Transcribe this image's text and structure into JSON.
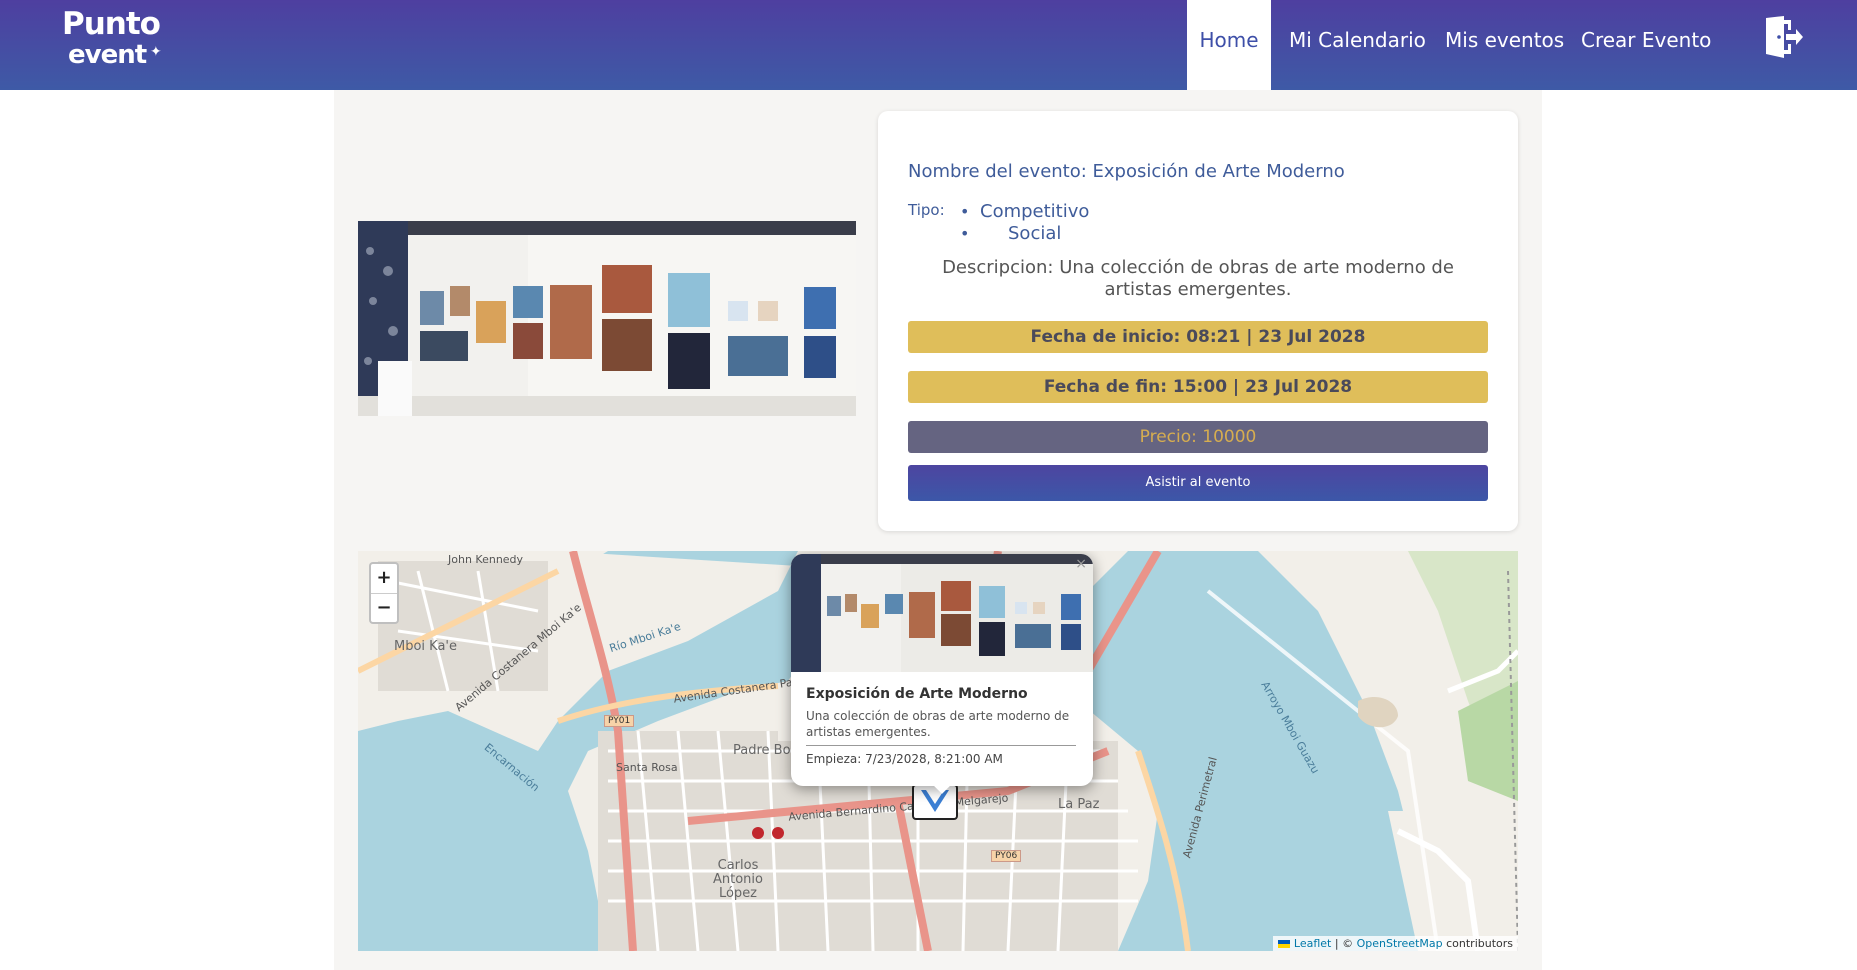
{
  "app": {
    "logo_line1": "Punto",
    "logo_line2": "event",
    "colors": {
      "nav_start": "#4e3fa0",
      "nav_end": "#3e5aa6",
      "date_bar": "#dfbe5a",
      "price_bar": "#656481",
      "accent_text": "#3f5c9a"
    }
  },
  "nav": {
    "items": [
      {
        "label": "Home",
        "active": true
      },
      {
        "label": "Mi Calendario",
        "active": false
      },
      {
        "label": "Mis eventos",
        "active": false
      },
      {
        "label": "Crear Evento",
        "active": false
      }
    ],
    "logout_icon": "logout-door-icon"
  },
  "event": {
    "name": "Nombre del evento: Exposición de Arte Moderno",
    "tipo_label": "Tipo:",
    "tipos": [
      "Competitivo",
      "Social"
    ],
    "description": "Descripcion: Una colección de obras de arte moderno de artistas emergentes.",
    "fecha_inicio": "Fecha de inicio: 08:21 | 23 Jul 2028",
    "fecha_fin": "Fecha de fin: 15:00 | 23 Jul 2028",
    "precio": "Precio: 10000",
    "attend_button": "Asistir al evento"
  },
  "map": {
    "zoom_in": "+",
    "zoom_out": "−",
    "labels": {
      "mboi_kae": "Mboi Ka'e",
      "rio_mboi": "Río Mboi Ka'e",
      "costanera_mboi": "Avenida Costanera Mboi Ka'e",
      "john_kennedy": "John Kennedy",
      "costanera_padre": "Avenida Costanera Padre",
      "padre_bolik": "Padre Bolik",
      "santa_rosa": "Santa Rosa",
      "encarnacion": "Encarnación",
      "bernardino": "Avenida Bernardino Caballero Melgarejo",
      "carlos_lopez": "Carlos Antonio López",
      "la_paz": "La Paz",
      "perimetral": "Avenida Perimetral",
      "arroyo": "Arroyo Mboi Guazu",
      "py01": "PY01",
      "py06": "PY06"
    },
    "popup": {
      "title": "Exposición de Arte Moderno",
      "description": "Una colección de obras de arte moderno de artistas emergentes.",
      "date": "Empieza: 7/23/2028, 8:21:00 AM",
      "close": "×"
    },
    "attribution": {
      "leaflet": "Leaflet",
      "sep": " | © ",
      "osm": "OpenStreetMap",
      "contributors": " contributors"
    }
  }
}
